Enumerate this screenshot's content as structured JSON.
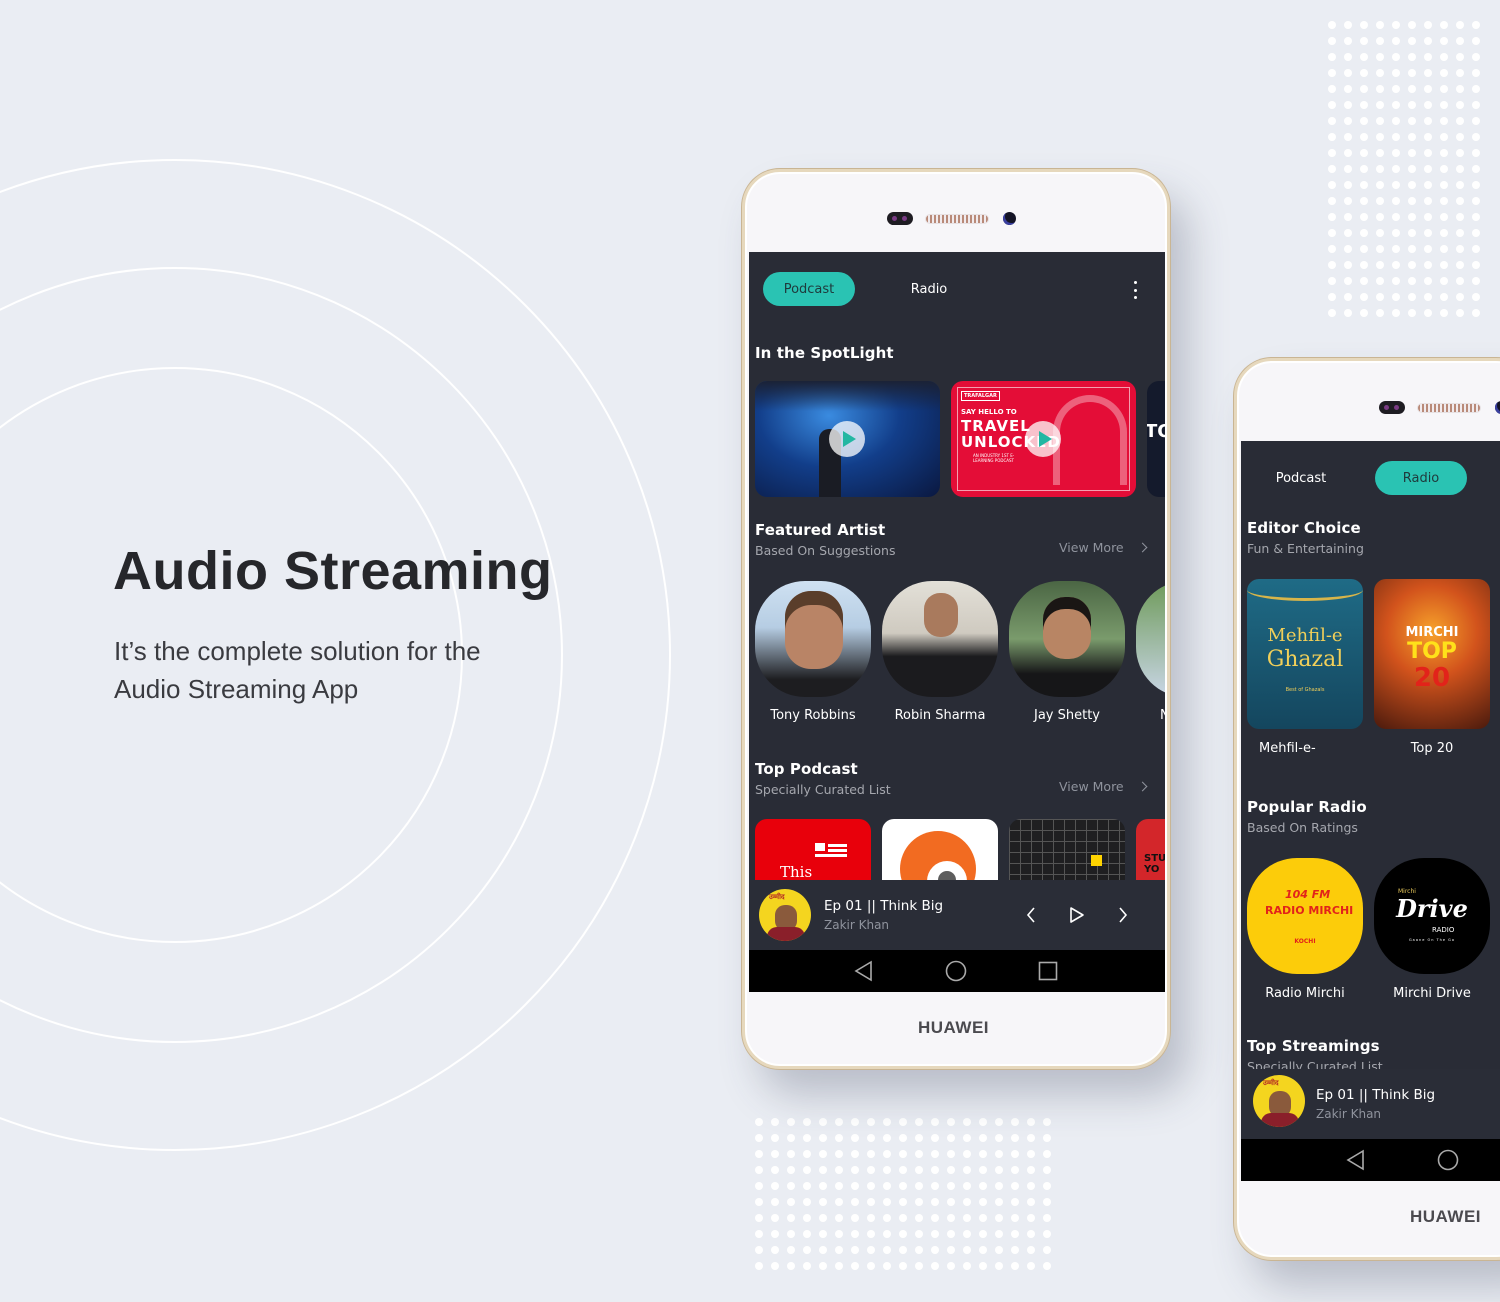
{
  "hero": {
    "title": "Audio Streaming",
    "subtitle": "It’s the complete solution for the Audio Streaming App"
  },
  "colors": {
    "background": "#eaedf3",
    "screen": "#292c36",
    "accent": "#2ac3b3",
    "muted_text": "#a5a7ae"
  },
  "phone_main": {
    "brand": "HUAWEI",
    "tabs": [
      {
        "label": "Podcast",
        "active": true
      },
      {
        "label": "Radio",
        "active": false
      }
    ],
    "menu_icon": "kebab-menu-icon",
    "spotlight": {
      "title": "In the SpotLight",
      "cards": [
        {
          "name": "Concert crowd",
          "icon": "play-icon"
        },
        {
          "name": "Travel Unlocked",
          "top": "TRAFALGAR",
          "line1": "SAY HELLO TO",
          "line2": "TRAVEL",
          "line3": "UNLOCKED",
          "tag": "AN INDUSTRY 1ST E-LEARNING PODCAST",
          "icon": "play-icon"
        },
        {
          "name": "Partial card",
          "text": "TOI"
        }
      ]
    },
    "featured_artist": {
      "title": "Featured Artist",
      "subtitle": "Based On Suggestions",
      "view_more": "View More",
      "artists": [
        {
          "name": "Tony Robbins"
        },
        {
          "name": "Robin Sharma"
        },
        {
          "name": "Jay Shetty"
        },
        {
          "name": "N"
        }
      ]
    },
    "top_podcast": {
      "title": "Top Podcast",
      "subtitle": "Specially Curated List",
      "view_more": "View More",
      "items": [
        {
          "label": "This"
        },
        {
          "label": ""
        },
        {
          "label": ""
        },
        {
          "label": "STU YO"
        }
      ]
    },
    "now_playing": {
      "title": "Ep 01 || Think Big",
      "artist": "Zakir Khan",
      "thumb_text": "उम्मीद"
    }
  },
  "phone_secondary": {
    "brand": "HUAWEI",
    "tabs": [
      {
        "label": "Podcast",
        "active": false
      },
      {
        "label": "Radio",
        "active": true
      }
    ],
    "editor_choice": {
      "title": "Editor Choice",
      "subtitle": "Fun & Entertaining",
      "items": [
        {
          "name": "Mehfil-e-",
          "art_line1": "Mehfil-e",
          "art_line2": "Ghazal",
          "art_caption": "Best of Ghazals"
        },
        {
          "name": "Top 20",
          "art_line1": "MIRCHI",
          "art_line2": "TOP",
          "art_line3": "20"
        }
      ]
    },
    "popular_radio": {
      "title": "Popular Radio",
      "subtitle": "Based On Ratings",
      "items": [
        {
          "name": "Radio Mirchi",
          "art_line1": "104 FM",
          "art_line2": "RADIO MIRCHI",
          "art_line3": "KOCHI"
        },
        {
          "name": "Mirchi Drive",
          "art_line1": "Mirchi",
          "art_line2": "Drive",
          "art_line3": "RADIO",
          "art_line4": "Gaane On The Go"
        }
      ]
    },
    "top_streamings": {
      "title": "Top Streamings",
      "subtitle": "Specially Curated List"
    },
    "now_playing": {
      "title": "Ep 01 || Think Big",
      "artist": "Zakir Khan",
      "thumb_text": "उम्मीद"
    }
  }
}
